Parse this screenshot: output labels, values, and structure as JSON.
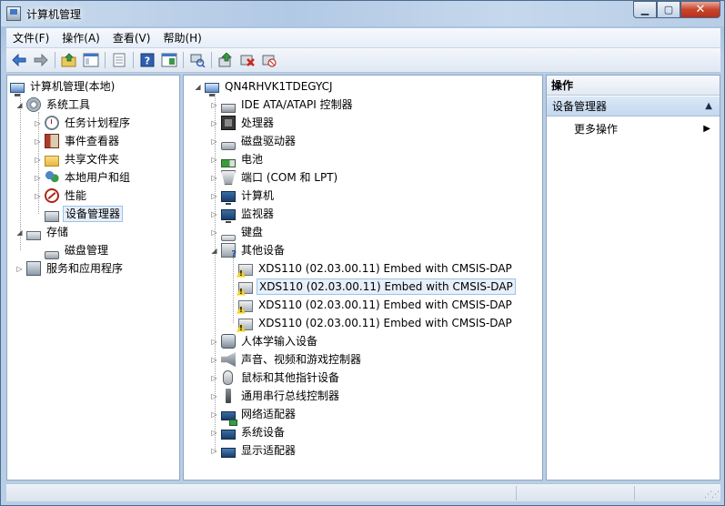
{
  "window": {
    "title": "计算机管理",
    "controls": {
      "minimize": "▁",
      "maximize": "▢",
      "close": "✕"
    }
  },
  "menu": [
    "文件(F)",
    "操作(A)",
    "查看(V)",
    "帮助(H)"
  ],
  "toolbar_icons": [
    "back-arrow-icon",
    "forward-arrow-icon",
    "up-folder-icon",
    "show-hide-tree-icon",
    "export-list-icon",
    "help-icon",
    "console-icon",
    "scan-hardware-icon",
    "update-driver-icon",
    "uninstall-icon",
    "disable-device-icon"
  ],
  "left_tree": {
    "root": "计算机管理(本地)",
    "system_tools": "系统工具",
    "task_scheduler": "任务计划程序",
    "event_viewer": "事件查看器",
    "shared_folders": "共享文件夹",
    "local_users": "本地用户和组",
    "performance": "性能",
    "device_manager": "设备管理器",
    "storage": "存储",
    "disk_management": "磁盘管理",
    "services": "服务和应用程序"
  },
  "device_tree": {
    "computer": "QN4RHVK1TDEGYCJ",
    "categories": {
      "ide": "IDE ATA/ATAPI 控制器",
      "processor": "处理器",
      "disk": "磁盘驱动器",
      "battery": "电池",
      "ports": "端口 (COM 和 LPT)",
      "computer": "计算机",
      "monitor": "监视器",
      "keyboard": "键盘",
      "other": "其他设备",
      "hid": "人体学输入设备",
      "sound": "声音、视频和游戏控制器",
      "mouse": "鼠标和其他指针设备",
      "usb": "通用串行总线控制器",
      "network": "网络适配器",
      "system": "系统设备",
      "display": "显示适配器"
    },
    "other_devices": [
      "XDS110 (02.03.00.11) Embed with CMSIS-DAP",
      "XDS110 (02.03.00.11) Embed with CMSIS-DAP",
      "XDS110 (02.03.00.11) Embed with CMSIS-DAP",
      "XDS110 (02.03.00.11) Embed with CMSIS-DAP"
    ]
  },
  "actions": {
    "header": "操作",
    "section": "设备管理器",
    "more": "更多操作"
  }
}
